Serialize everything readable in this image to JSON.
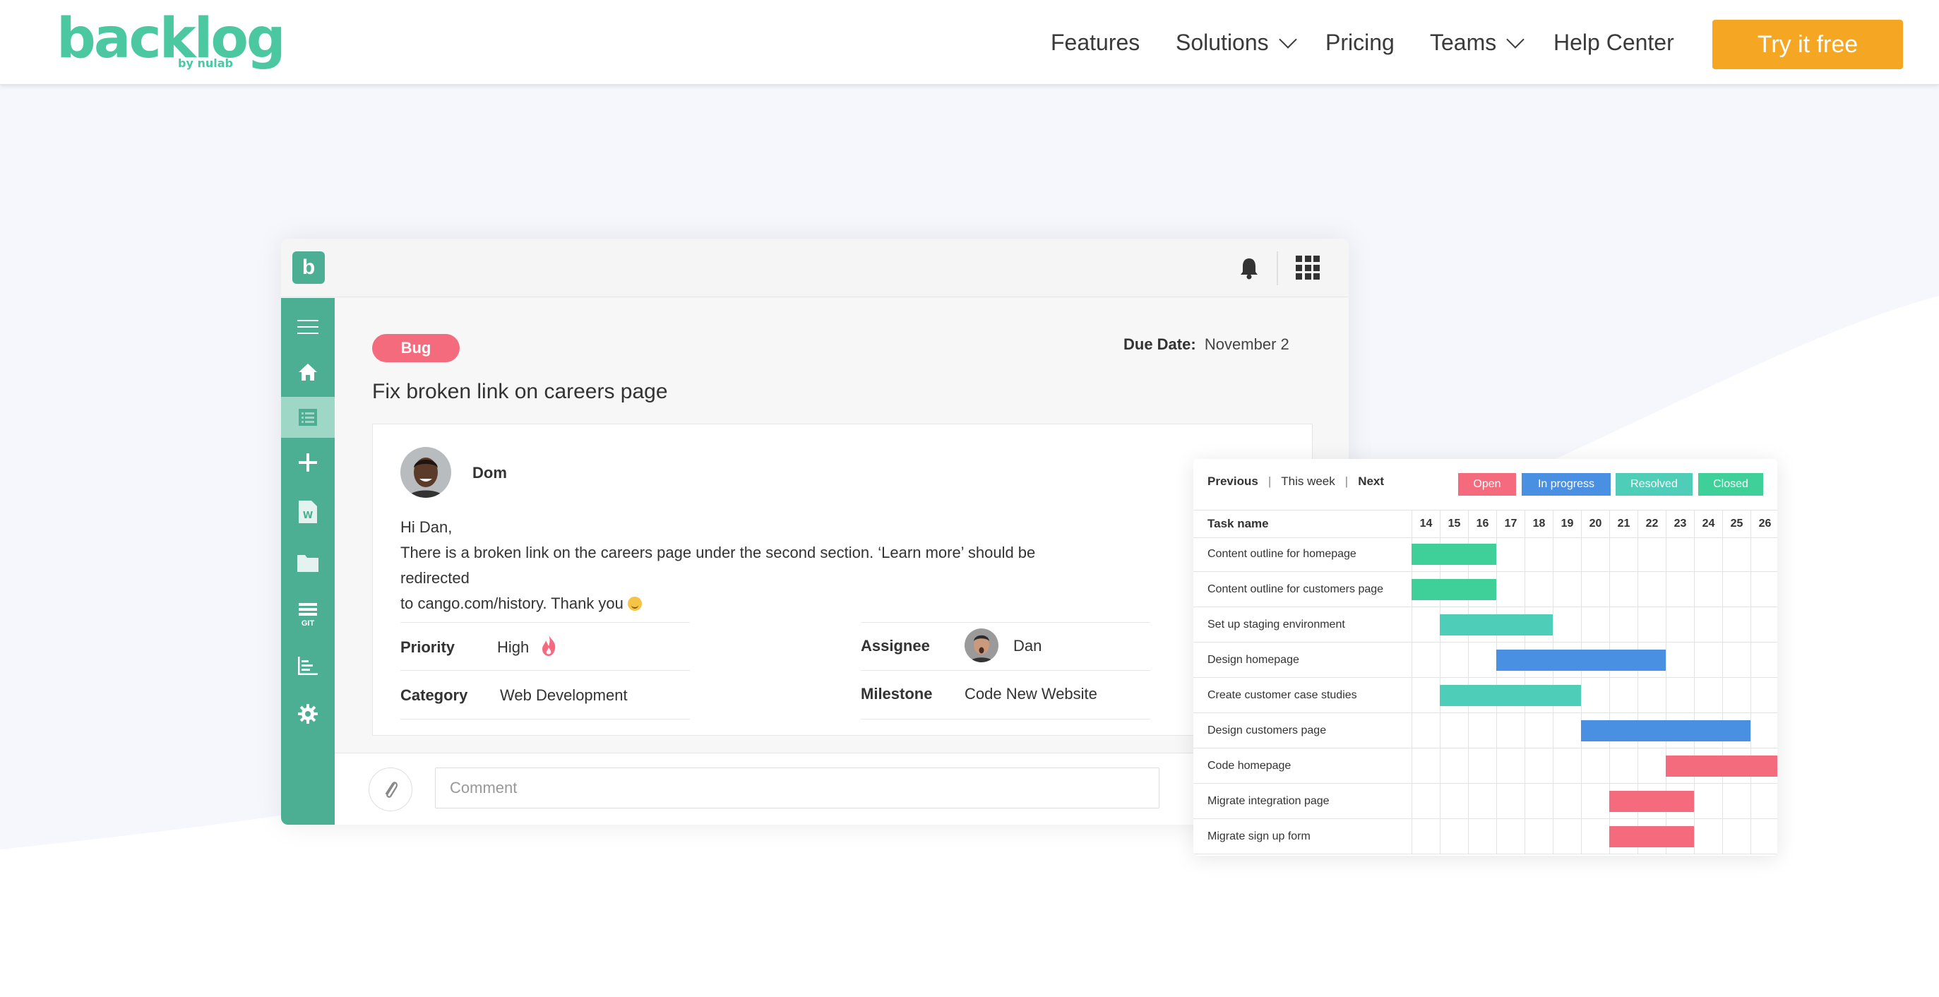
{
  "header": {
    "logo_text": "backlog",
    "logo_by": "by nulab",
    "nav": [
      {
        "label": "Features",
        "dropdown": false
      },
      {
        "label": "Solutions",
        "dropdown": true
      },
      {
        "label": "Pricing",
        "dropdown": false
      },
      {
        "label": "Teams",
        "dropdown": true
      },
      {
        "label": "Help Center",
        "dropdown": false
      }
    ],
    "cta_label": "Try it free"
  },
  "colors": {
    "brand": "#4cc8a1",
    "sidebar": "#4caf94",
    "cta": "#f5a623",
    "bug": "#f46b7d",
    "open": "#f46b7d",
    "in_progress": "#4a90e2",
    "resolved": "#4ecdb8",
    "closed": "#3fd09a"
  },
  "app": {
    "logo_letter": "b",
    "sidebar_icons": [
      "menu-icon",
      "home-icon",
      "list-icon",
      "plus-icon",
      "wiki-icon",
      "folder-icon",
      "git-icon",
      "chart-icon",
      "gear-icon"
    ],
    "git_label": "GIT",
    "wiki_label": "W",
    "issue": {
      "badge": "Bug",
      "due_label": "Due Date:",
      "due_value": "November 2",
      "title": "Fix broken link on careers page",
      "author": "Dom",
      "message_line1": "Hi Dan,",
      "message_line2": "There is a broken link on the careers page under the second section. ‘Learn more’ should be redirected",
      "message_line3": "to cango.com/history. Thank you",
      "fields": {
        "priority_label": "Priority",
        "priority_value": "High",
        "category_label": "Category",
        "category_value": "Web Development",
        "assignee_label": "Assignee",
        "assignee_value": "Dan",
        "milestone_label": "Milestone",
        "milestone_value": "Code New Website"
      }
    },
    "comment_placeholder": "Comment"
  },
  "gantt": {
    "nav_previous": "Previous",
    "nav_this_week": "This week",
    "nav_next": "Next",
    "legend": [
      "Open",
      "In progress",
      "Resolved",
      "Closed"
    ],
    "task_header": "Task name",
    "days": [
      "14",
      "15",
      "16",
      "17",
      "18",
      "19",
      "20",
      "21",
      "22",
      "23",
      "24",
      "25",
      "26"
    ],
    "tasks": [
      {
        "name": "Content outline for homepage",
        "start": 14,
        "end": 16,
        "status": "closed"
      },
      {
        "name": "Content outline for customers page",
        "start": 14,
        "end": 16,
        "status": "closed"
      },
      {
        "name": "Set up staging environment",
        "start": 15,
        "end": 18,
        "status": "resolved"
      },
      {
        "name": "Design homepage",
        "start": 17,
        "end": 22,
        "status": "in_progress"
      },
      {
        "name": "Create customer case studies",
        "start": 15,
        "end": 19,
        "status": "resolved"
      },
      {
        "name": "Design customers page",
        "start": 20,
        "end": 25,
        "status": "in_progress"
      },
      {
        "name": "Code homepage",
        "start": 23,
        "end": 26,
        "status": "open"
      },
      {
        "name": "Migrate integration page",
        "start": 21,
        "end": 23,
        "status": "open"
      },
      {
        "name": "Migrate sign up form",
        "start": 21,
        "end": 23,
        "status": "open"
      }
    ]
  }
}
